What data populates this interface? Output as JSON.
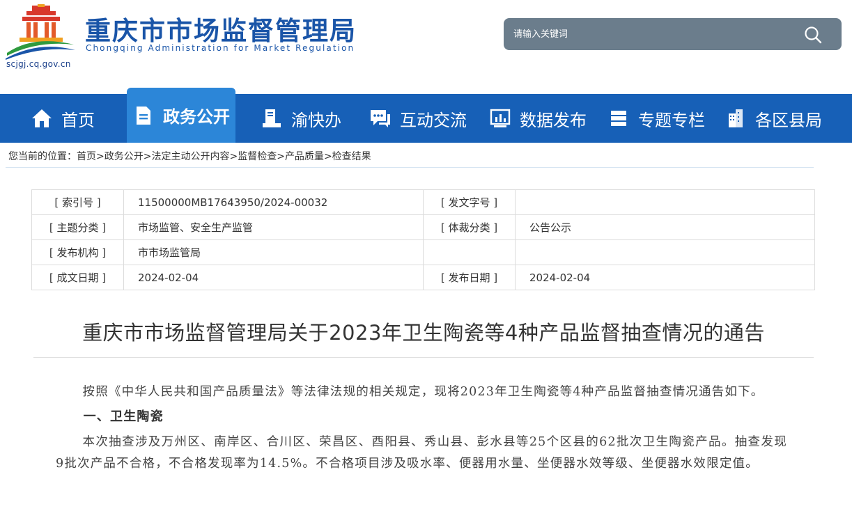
{
  "header": {
    "site_title": "重庆市市场监督管理局",
    "site_subtitle": "Chongqing Administration for Market Regulation",
    "domain": "scjgj.cq.gov.cn",
    "search_placeholder": "请输入关键词",
    "brand_color": "#1760b7"
  },
  "nav": {
    "items": [
      {
        "label": "首页",
        "icon": "home-icon"
      },
      {
        "label": "政务公开",
        "icon": "document-icon",
        "active": true
      },
      {
        "label": "渝快办",
        "icon": "reader-icon"
      },
      {
        "label": "互动交流",
        "icon": "chat-icon"
      },
      {
        "label": "数据发布",
        "icon": "chart-icon"
      },
      {
        "label": "专题专栏",
        "icon": "list-icon"
      },
      {
        "label": "各区县局",
        "icon": "building-icon"
      }
    ]
  },
  "breadcrumb": {
    "prefix": "您当前的位置：",
    "items": [
      "首页",
      "政务公开",
      "法定主动公开内容",
      "监督检查",
      "产品质量",
      "检查结果"
    ],
    "separator": ">"
  },
  "meta": {
    "index_label": "[ 索引号 ]",
    "index_value": "11500000MB17643950/2024-00032",
    "docno_label": "[ 发文字号 ]",
    "docno_value": "",
    "topic_label": "[ 主题分类 ]",
    "topic_value": "市场监管、安全生产监管",
    "genre_label": "[ 体裁分类 ]",
    "genre_value": "公告公示",
    "org_label": "[ 发布机构 ]",
    "org_value": "市市场监管局",
    "created_label": "[ 成文日期 ]",
    "created_value": "2024-02-04",
    "published_label": "[ 发布日期 ]",
    "published_value": "2024-02-04"
  },
  "article": {
    "title": "重庆市市场监督管理局关于2023年卫生陶瓷等4种产品监督抽查情况的通告",
    "intro": "按照《中华人民共和国产品质量法》等法律法规的相关规定，现将2023年卫生陶瓷等4种产品监督抽查情况通告如下。",
    "section1_heading": "一、卫生陶瓷",
    "section1_body": "本次抽查涉及万州区、南岸区、合川区、荣昌区、酉阳县、秀山县、彭水县等25个区县的62批次卫生陶瓷产品。抽查发现9批次产品不合格，不合格发现率为14.5%。不合格项目涉及吸水率、便器用水量、坐便器水效等级、坐便器水效限定值。"
  }
}
